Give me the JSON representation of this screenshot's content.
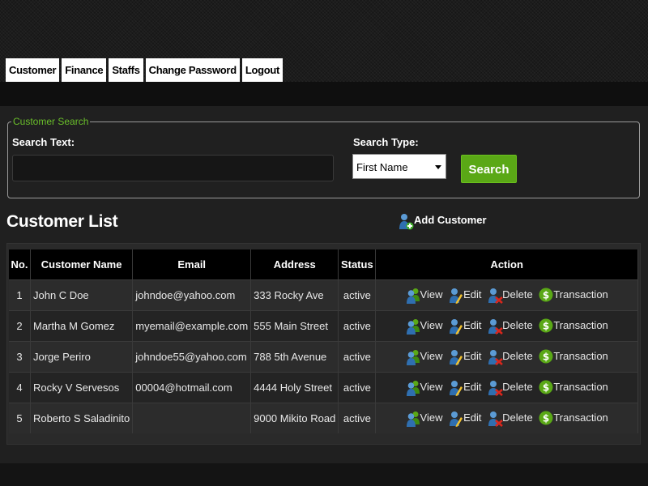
{
  "nav": {
    "tabs": [
      {
        "label": "Customer"
      },
      {
        "label": "Finance"
      },
      {
        "label": "Staffs"
      },
      {
        "label": "Change Password"
      },
      {
        "label": "Logout"
      }
    ]
  },
  "search": {
    "legend": "Customer Search",
    "text_label": "Search Text:",
    "text_value": "",
    "type_label": "Search Type:",
    "type_selected": "First Name",
    "button_label": "Search"
  },
  "list": {
    "title": "Customer List",
    "add_label": "Add Customer",
    "columns": [
      "No.",
      "Customer Name",
      "Email",
      "Address",
      "Status",
      "Action"
    ],
    "actions": {
      "view": "View",
      "edit": "Edit",
      "delete": "Delete",
      "transaction": "Transaction"
    },
    "rows": [
      {
        "no": "1",
        "name": "John C Doe",
        "email": "johndoe@yahoo.com",
        "address": "333 Rocky Ave",
        "status": "active"
      },
      {
        "no": "2",
        "name": "Martha M Gomez",
        "email": "myemail@example.com",
        "address": "555 Main Street",
        "status": "active"
      },
      {
        "no": "3",
        "name": "Jorge Periro",
        "email": "johndoe55@yahoo.com",
        "address": "788 5th Avenue",
        "status": "active"
      },
      {
        "no": "4",
        "name": "Rocky V Servesos",
        "email": "00004@hotmail.com",
        "address": "4444 Holy Street",
        "status": "active"
      },
      {
        "no": "5",
        "name": "Roberto S Saladinito",
        "email": "",
        "address": "9000 Mikito Road",
        "status": "active"
      }
    ]
  },
  "colors": {
    "accent_green": "#5aa816",
    "legend_green": "#6abf2a",
    "panel": "#202020"
  },
  "icons": {
    "add_customer": "user-add-icon",
    "view": "users-icon",
    "edit": "user-edit-icon",
    "delete": "user-delete-icon",
    "transaction": "dollar-coin-icon"
  }
}
